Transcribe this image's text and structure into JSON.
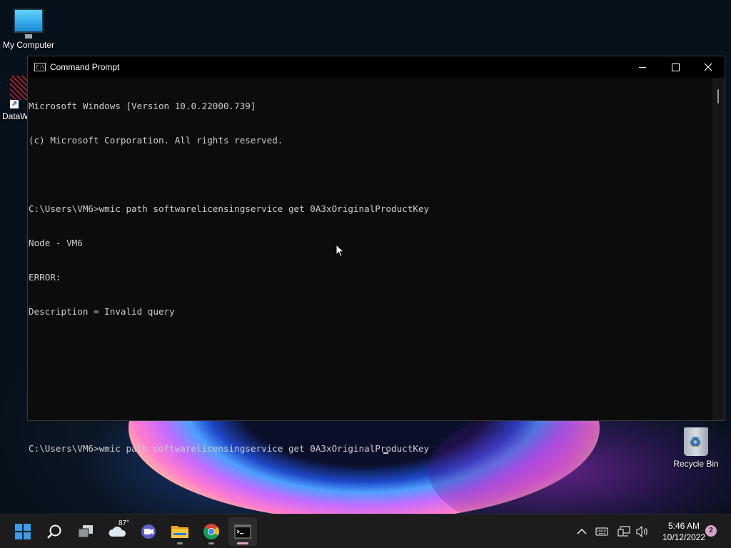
{
  "desktop": {
    "icons": [
      {
        "label": "My Computer"
      },
      {
        "label": "DataW"
      },
      {
        "label": "Recycle Bin"
      }
    ]
  },
  "window": {
    "title": "Command Prompt",
    "icon": "cmd-icon",
    "controls": [
      "minimize-icon",
      "maximize-icon",
      "close-icon"
    ],
    "lines": [
      "Microsoft Windows [Version 10.0.22000.739]",
      "(c) Microsoft Corporation. All rights reserved.",
      "",
      "C:\\Users\\VM6>wmic path softwarelicensingservice get 0A3xOriginalProductKey",
      "Node - VM6",
      "ERROR:",
      "Description = Invalid query",
      "",
      "",
      "",
      "C:\\Users\\VM6>wmic path softwarelicensingservice get 0A3xOriginalProductKey"
    ]
  },
  "taskbar": {
    "weather_temp": "87°",
    "apps": [
      "start-icon",
      "search-icon",
      "task-view-icon",
      "weather-icon",
      "teams-chat-icon",
      "file-explorer-icon",
      "chrome-icon",
      "terminal-icon"
    ],
    "tray_icons": [
      "chevron-up-icon",
      "keyboard-icon",
      "network-icon",
      "volume-icon"
    ],
    "time": "5:46 AM",
    "date": "10/12/2022",
    "notifications": "2"
  }
}
